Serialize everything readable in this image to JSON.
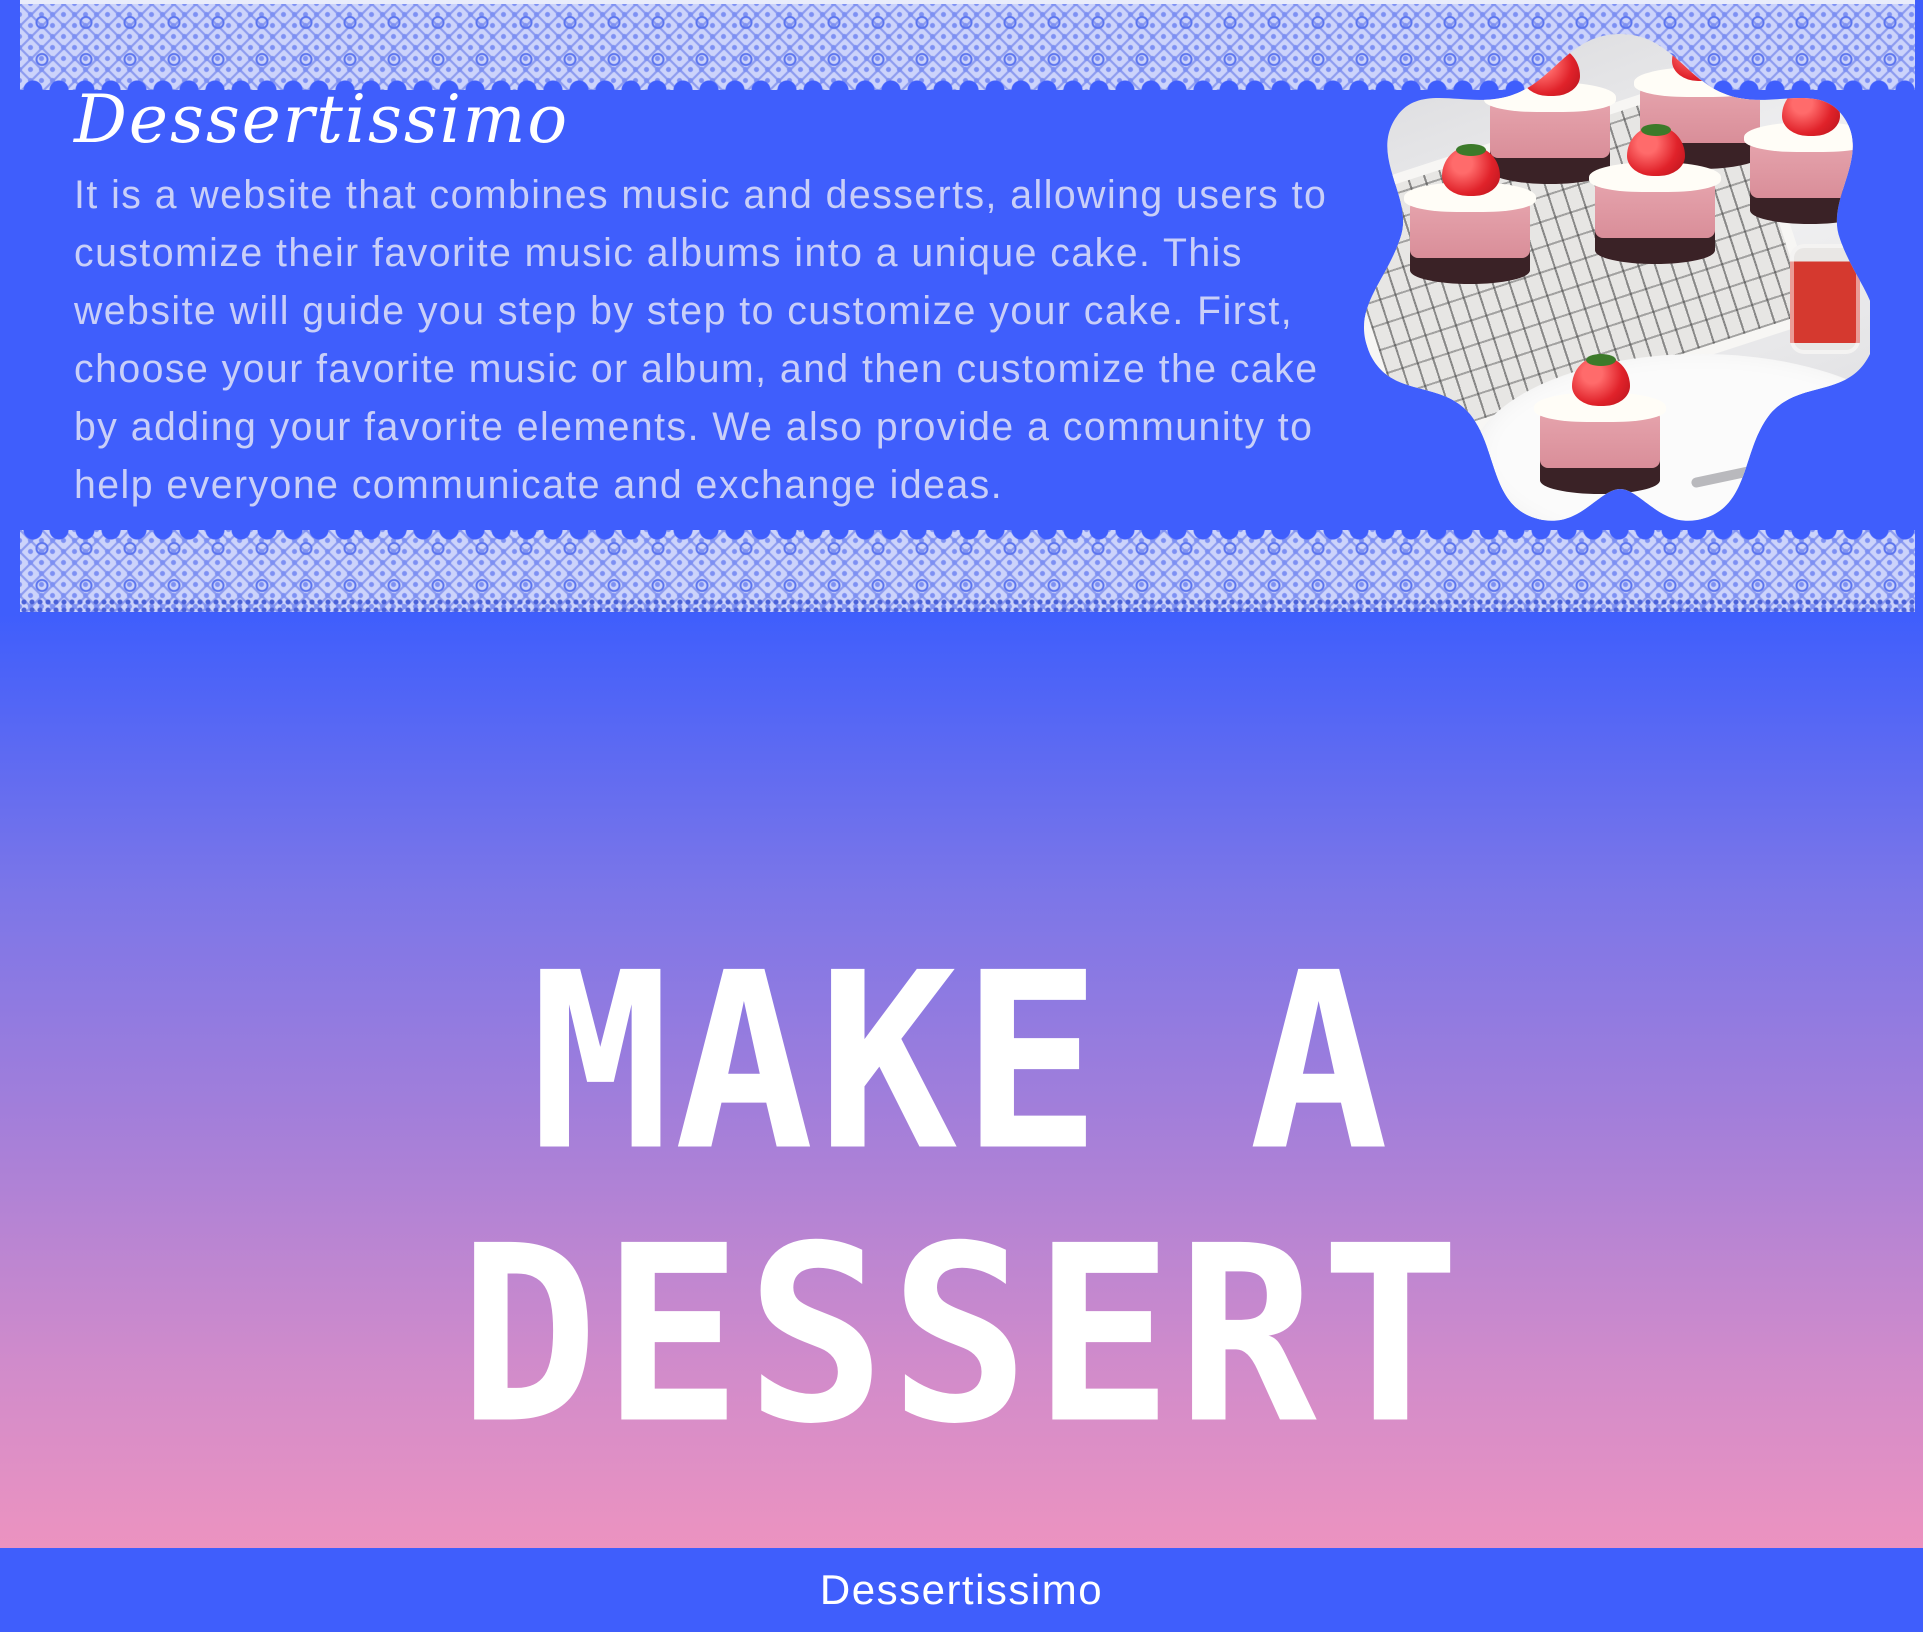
{
  "about": {
    "brand": "Dessertissimo",
    "description": "It is a website that combines music and desserts, allowing users to customize their favorite music albums into a unique cake. This website will guide you step by step to customize your cake. First, choose your favorite music or album, and then customize the cake by adding your favorite elements. We also provide a community to help everyone communicate and exchange ideas."
  },
  "hero": {
    "title": "MAKE A DESSERT"
  },
  "footer": {
    "text": "Dessertissimo"
  },
  "colors": {
    "primary_blue": "#3f5efc",
    "gradient_bottom_pink": "#ec93c0",
    "lace": "#ccd3fb",
    "text_light": "#c9cff8"
  }
}
